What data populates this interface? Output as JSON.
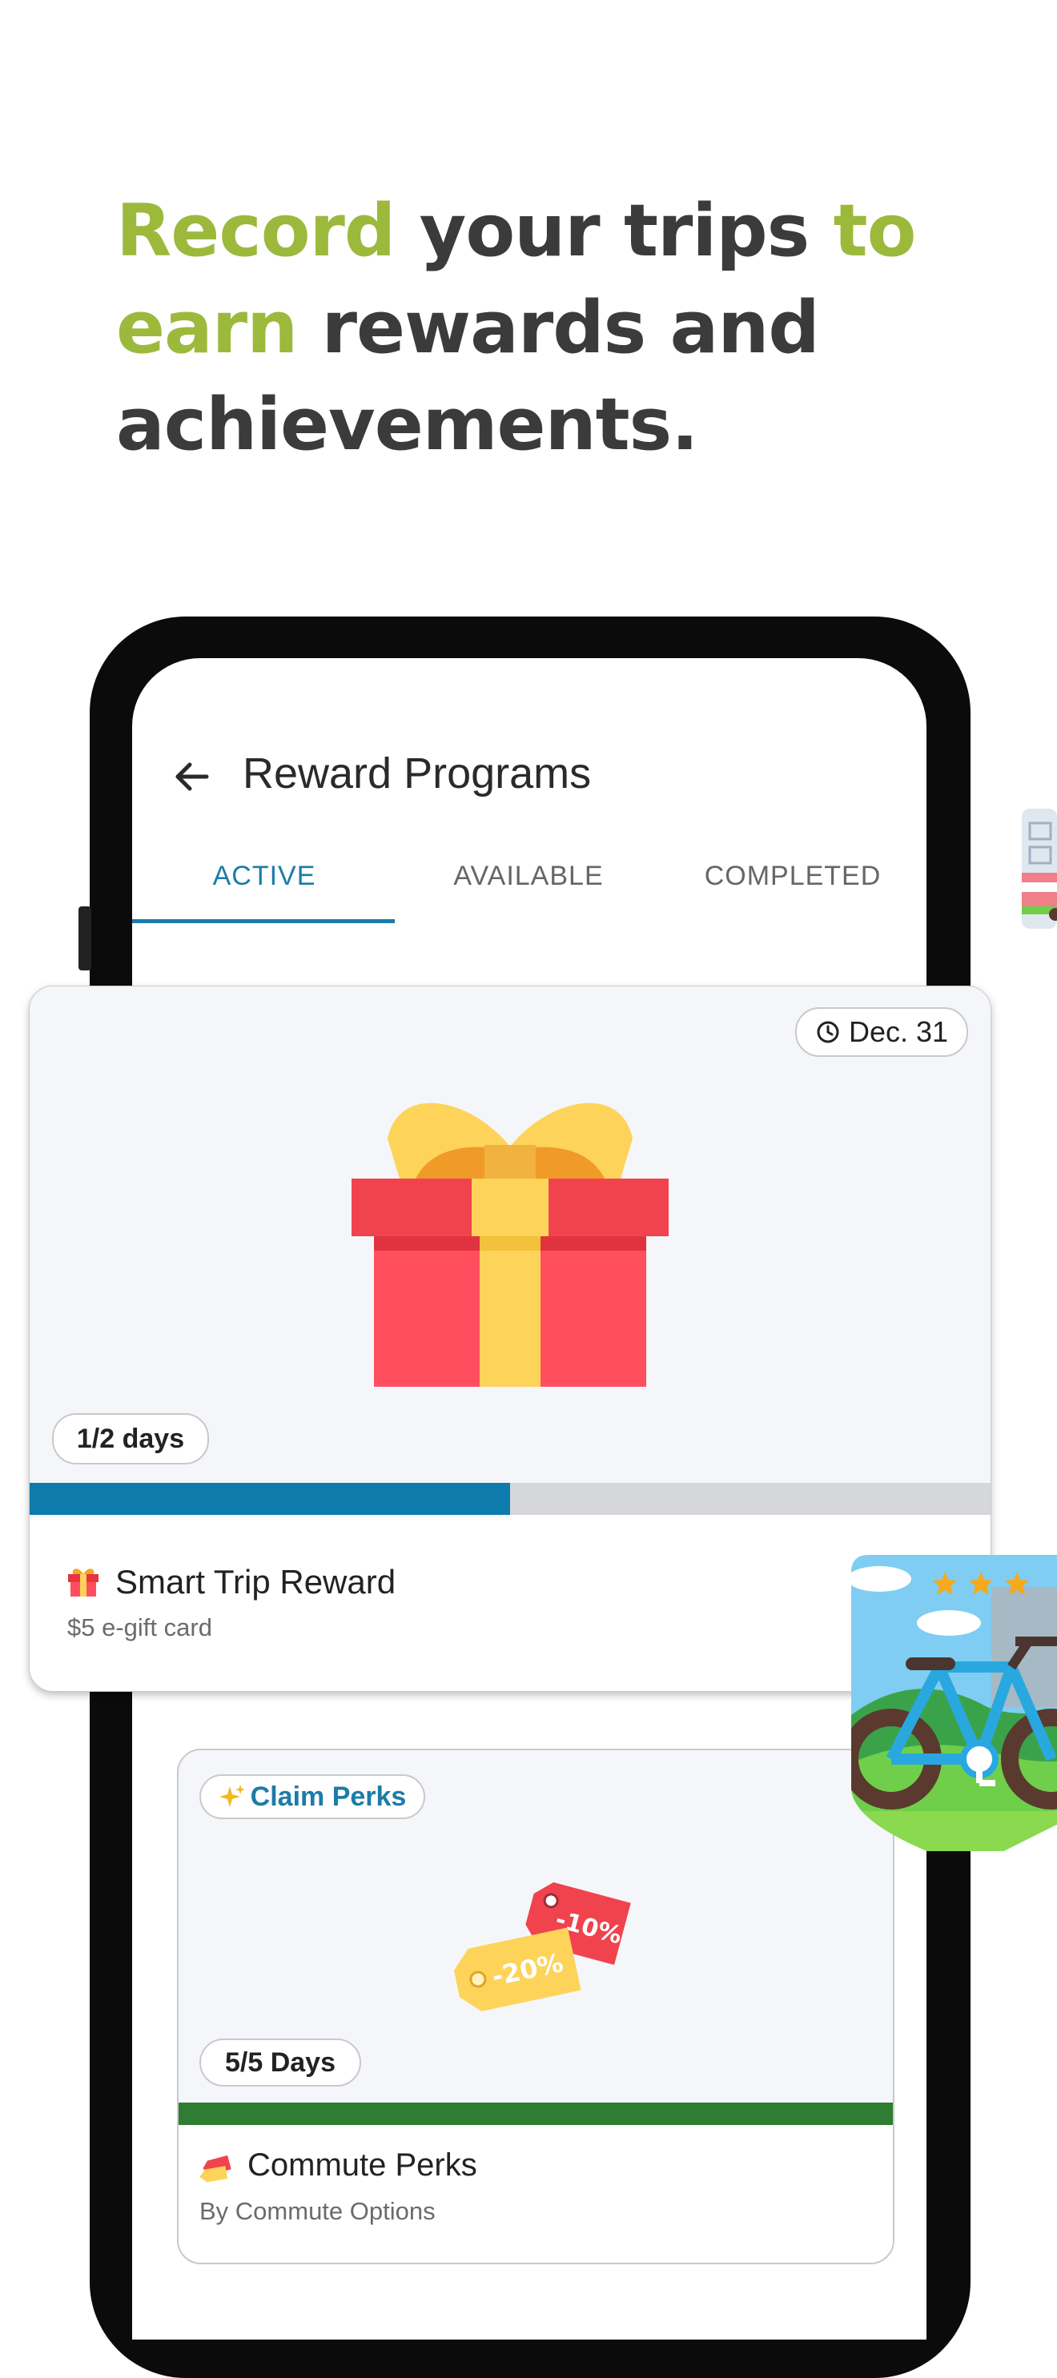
{
  "headline": {
    "part1": "Record",
    "part2": " your trips ",
    "part3": "to earn",
    "part4": " rewards and achievements."
  },
  "colors": {
    "accent_green": "#9cb93c",
    "headline_dark": "#3b3b3b",
    "primary_blue": "#1c7ca9",
    "progress_green": "#2e7d32"
  },
  "appbar": {
    "back_icon": "arrow-left-icon",
    "title": "Reward Programs"
  },
  "tabs": [
    {
      "label": "ACTIVE",
      "active": true
    },
    {
      "label": "AVAILABLE",
      "active": false
    },
    {
      "label": "COMPLETED",
      "active": false
    }
  ],
  "card1": {
    "date": "Dec. 31",
    "date_icon": "clock-icon",
    "progress_label": "1/2 days",
    "progress_fraction": 0.5,
    "title_icon": "gift-icon",
    "title": "Smart Trip Reward",
    "subtitle": "$5 e-gift card",
    "image": "gift-box-illustration"
  },
  "card2": {
    "chip_icon": "sparkles-icon",
    "chip_label": "Claim Perks",
    "progress_label": "5/5 Days",
    "progress_fraction": 1.0,
    "title_icon": "price-tag-icon",
    "title": "Commute Perks",
    "subtitle": "By Commute Options",
    "tag1": "-10%",
    "tag2": "-20%"
  },
  "badge": {
    "image": "bike-achievement-badge",
    "stars": 3
  }
}
